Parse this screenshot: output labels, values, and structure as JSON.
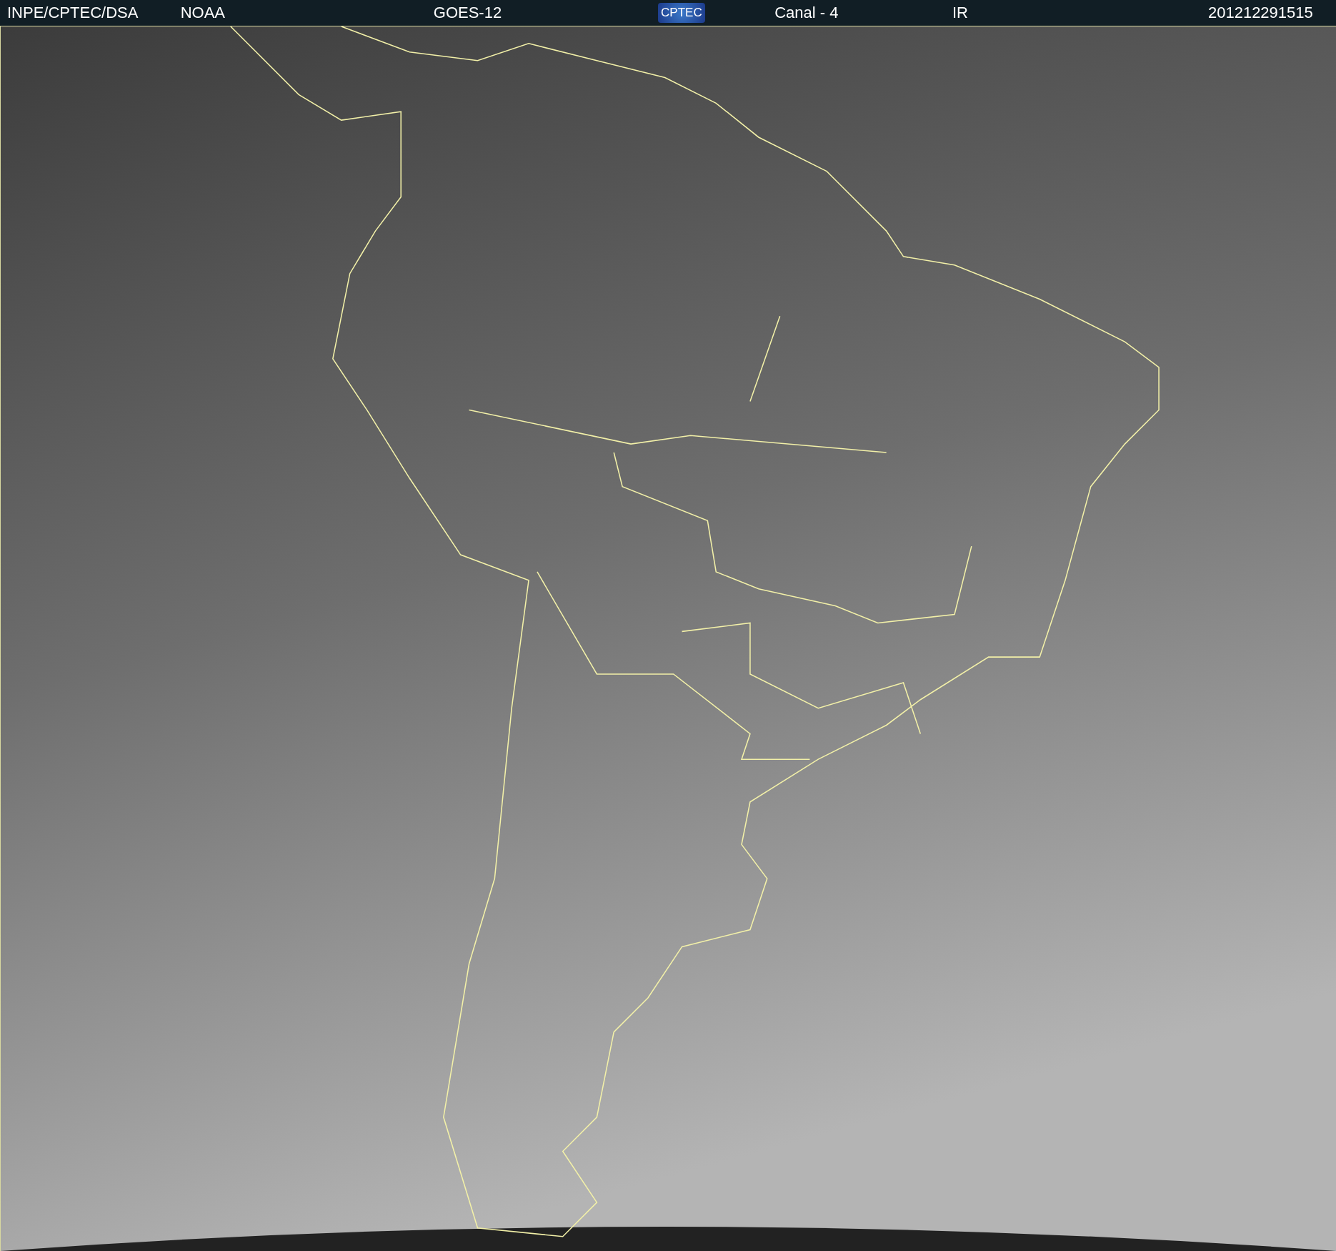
{
  "header": {
    "labels": [
      {
        "kind": "text",
        "text": "INPE/CPTEC/DSA"
      },
      {
        "kind": "text",
        "text": "NOAA"
      },
      {
        "kind": "text",
        "text": "GOES-12"
      },
      {
        "kind": "logo",
        "text": "CPTEC"
      },
      {
        "kind": "text",
        "text": "Canal - 4"
      },
      {
        "kind": "text",
        "text": "IR"
      },
      {
        "kind": "text",
        "text": "201212291515"
      }
    ]
  }
}
